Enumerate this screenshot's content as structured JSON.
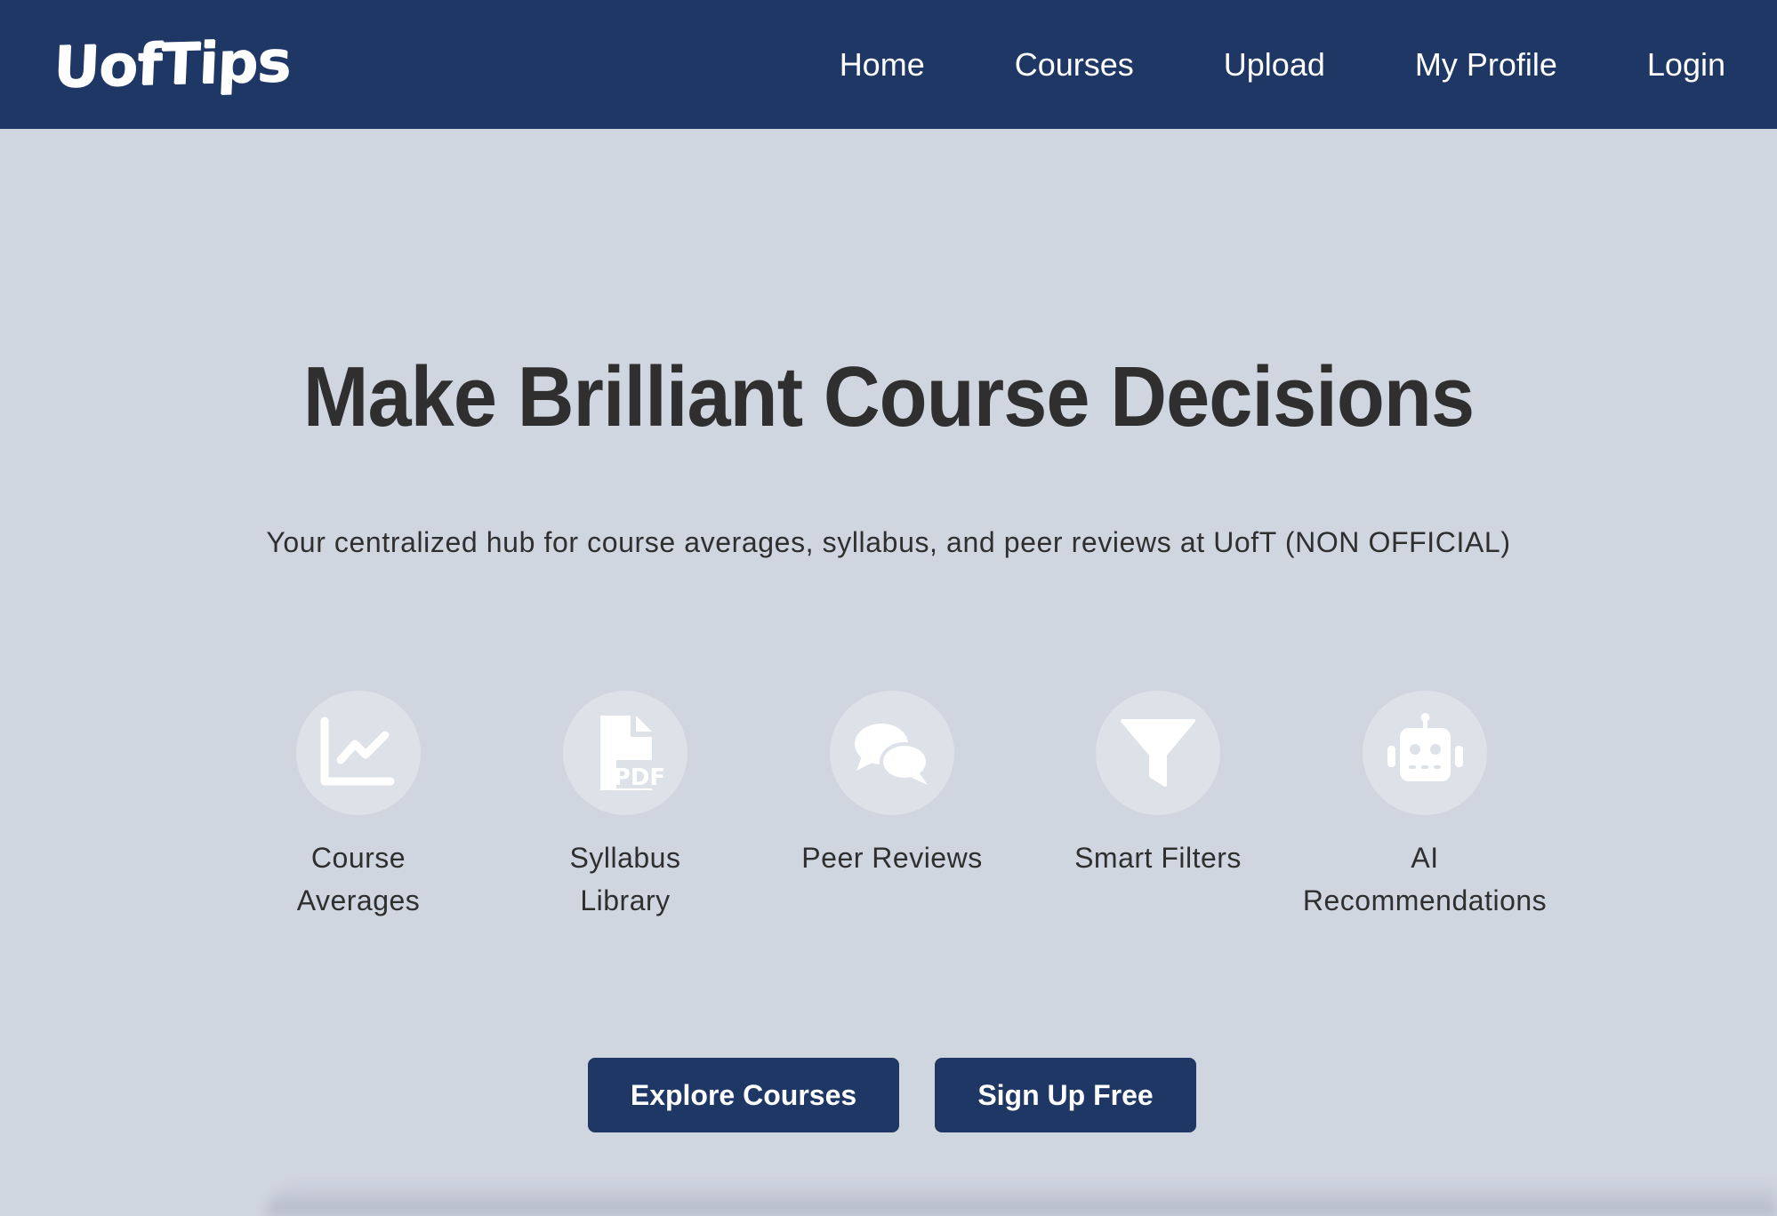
{
  "nav": {
    "logo": "UofTips",
    "links": [
      "Home",
      "Courses",
      "Upload",
      "My Profile",
      "Login"
    ]
  },
  "hero": {
    "title": "Make Brilliant Course Decisions",
    "subtitle": "Your centralized hub for course averages, syllabus, and peer reviews at UofT (NON OFFICIAL)"
  },
  "features": [
    {
      "icon": "chart-line-icon",
      "label_line1": "Course",
      "label_line2": "Averages"
    },
    {
      "icon": "file-pdf-icon",
      "label_line1": "Syllabus",
      "label_line2": "Library"
    },
    {
      "icon": "comments-icon",
      "label_line1": "Peer Reviews",
      "label_line2": ""
    },
    {
      "icon": "filter-icon",
      "label_line1": "Smart Filters",
      "label_line2": ""
    },
    {
      "icon": "robot-icon",
      "label_line1": "AI",
      "label_line2": "Recommendations"
    }
  ],
  "actions": {
    "explore": "Explore Courses",
    "signup": "Sign Up Free"
  },
  "colors": {
    "navbar": "#1f3765",
    "background": "#d0d6e0",
    "icon_circle": "#dde1e8",
    "text": "#2f2f2f"
  }
}
